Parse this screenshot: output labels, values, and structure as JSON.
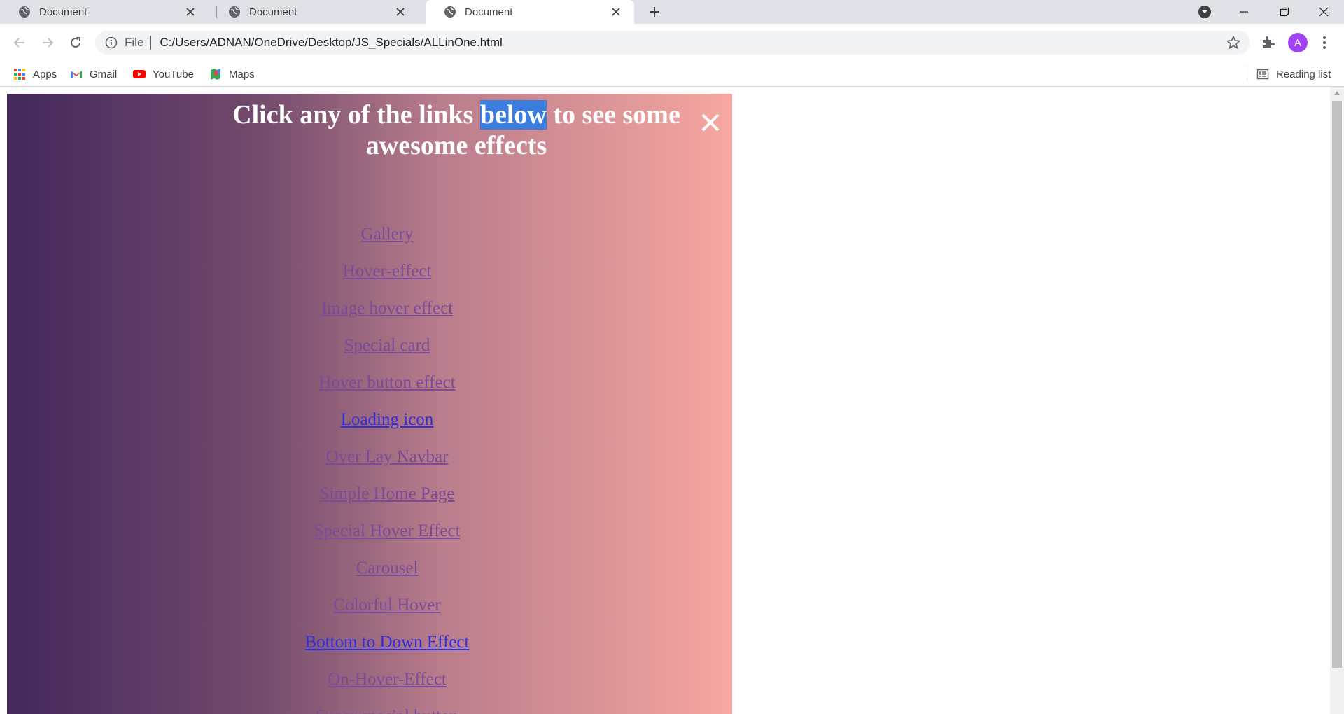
{
  "browser": {
    "tabs": [
      {
        "title": "Document",
        "active": false
      },
      {
        "title": "Document",
        "active": false
      },
      {
        "title": "Document",
        "active": true
      }
    ],
    "address": {
      "scheme_label": "File",
      "url": "C:/Users/ADNAN/OneDrive/Desktop/JS_Specials/ALLinOne.html"
    },
    "profile_initial": "A",
    "bookmarks": [
      {
        "label": "Apps",
        "icon": "apps-grid-icon"
      },
      {
        "label": "Gmail",
        "icon": "gmail-icon"
      },
      {
        "label": "YouTube",
        "icon": "youtube-icon"
      },
      {
        "label": "Maps",
        "icon": "maps-icon"
      }
    ],
    "reading_list_label": "Reading list"
  },
  "page": {
    "heading_before": "Click any of the links ",
    "heading_selected": "below",
    "heading_after": " to see some awesome effects",
    "close_symbol": "✕",
    "links": [
      {
        "label": "Gallery",
        "visited": true
      },
      {
        "label": "Hover-effect",
        "visited": true
      },
      {
        "label": "Image hover effect",
        "visited": true
      },
      {
        "label": "Special card",
        "visited": true
      },
      {
        "label": "Hover button effect",
        "visited": true
      },
      {
        "label": "Loading icon",
        "visited": false
      },
      {
        "label": "Over Lay Navbar",
        "visited": true
      },
      {
        "label": "Simple Home Page",
        "visited": true
      },
      {
        "label": "Special Hover Effect",
        "visited": true
      },
      {
        "label": "Carousel",
        "visited": true
      },
      {
        "label": "Colorful Hover",
        "visited": true
      },
      {
        "label": "Bottom to Down Effect",
        "visited": false
      },
      {
        "label": "On-Hover-Effect",
        "visited": true
      },
      {
        "label": "Super special button",
        "visited": true
      }
    ]
  },
  "colors": {
    "gradient_start": "#42275a",
    "gradient_end": "#f7a7a0",
    "visited_link": "#7b4a98",
    "unvisited_link": "#2f2fdd",
    "selection": "#3b7ddd"
  }
}
